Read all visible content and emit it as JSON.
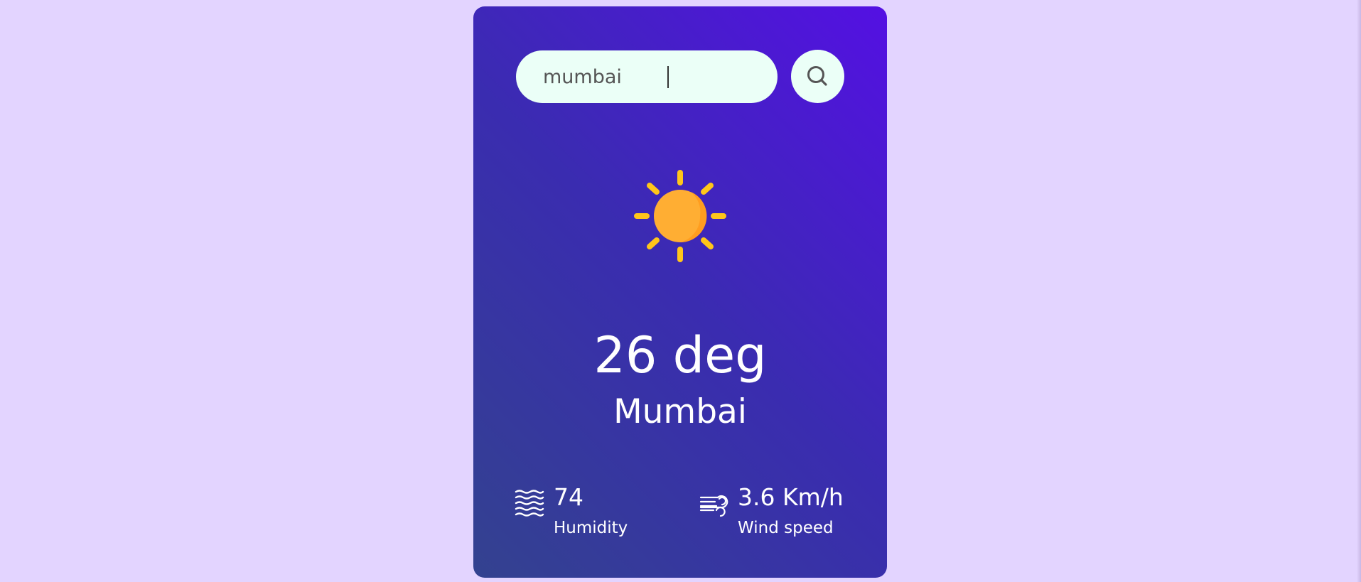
{
  "search": {
    "value": "mumbai",
    "icon": "search-icon"
  },
  "weather": {
    "icon": "sun-icon",
    "temperature": "26 deg",
    "city": "Mumbai"
  },
  "details": {
    "humidity": {
      "icon": "humidity-icon",
      "value": "74",
      "label": "Humidity"
    },
    "wind": {
      "icon": "wind-icon",
      "value": "3.6 Km/h",
      "label": "Wind speed"
    }
  },
  "colors": {
    "page_background": "#e3d4ff",
    "card_gradient_start": "#33428f",
    "card_gradient_end": "#5410e3",
    "input_background": "#ebfff7",
    "sun_core": "#ffae33",
    "sun_rays": "#ffc61a"
  }
}
